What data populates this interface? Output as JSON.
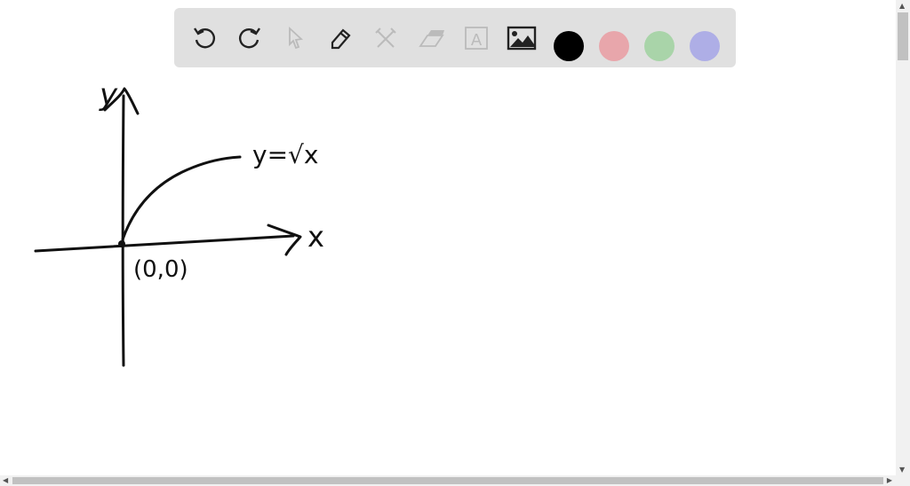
{
  "toolbar": {
    "tools": [
      {
        "name": "undo-icon",
        "enabled": true
      },
      {
        "name": "redo-icon",
        "enabled": true
      },
      {
        "name": "select-icon",
        "enabled": false
      },
      {
        "name": "pen-icon",
        "enabled": true
      },
      {
        "name": "tools-icon",
        "enabled": false
      },
      {
        "name": "eraser-icon",
        "enabled": false
      },
      {
        "name": "text-icon",
        "enabled": false
      },
      {
        "name": "image-icon",
        "enabled": true
      }
    ],
    "text_tool_glyph": "A",
    "colors": [
      "#000000",
      "#e8a6ab",
      "#a9d4a9",
      "#aeaee6"
    ]
  },
  "drawing": {
    "y_axis_label": "y",
    "x_axis_label": "x",
    "curve_label": "y=√x",
    "origin_label": "(0,0)"
  }
}
